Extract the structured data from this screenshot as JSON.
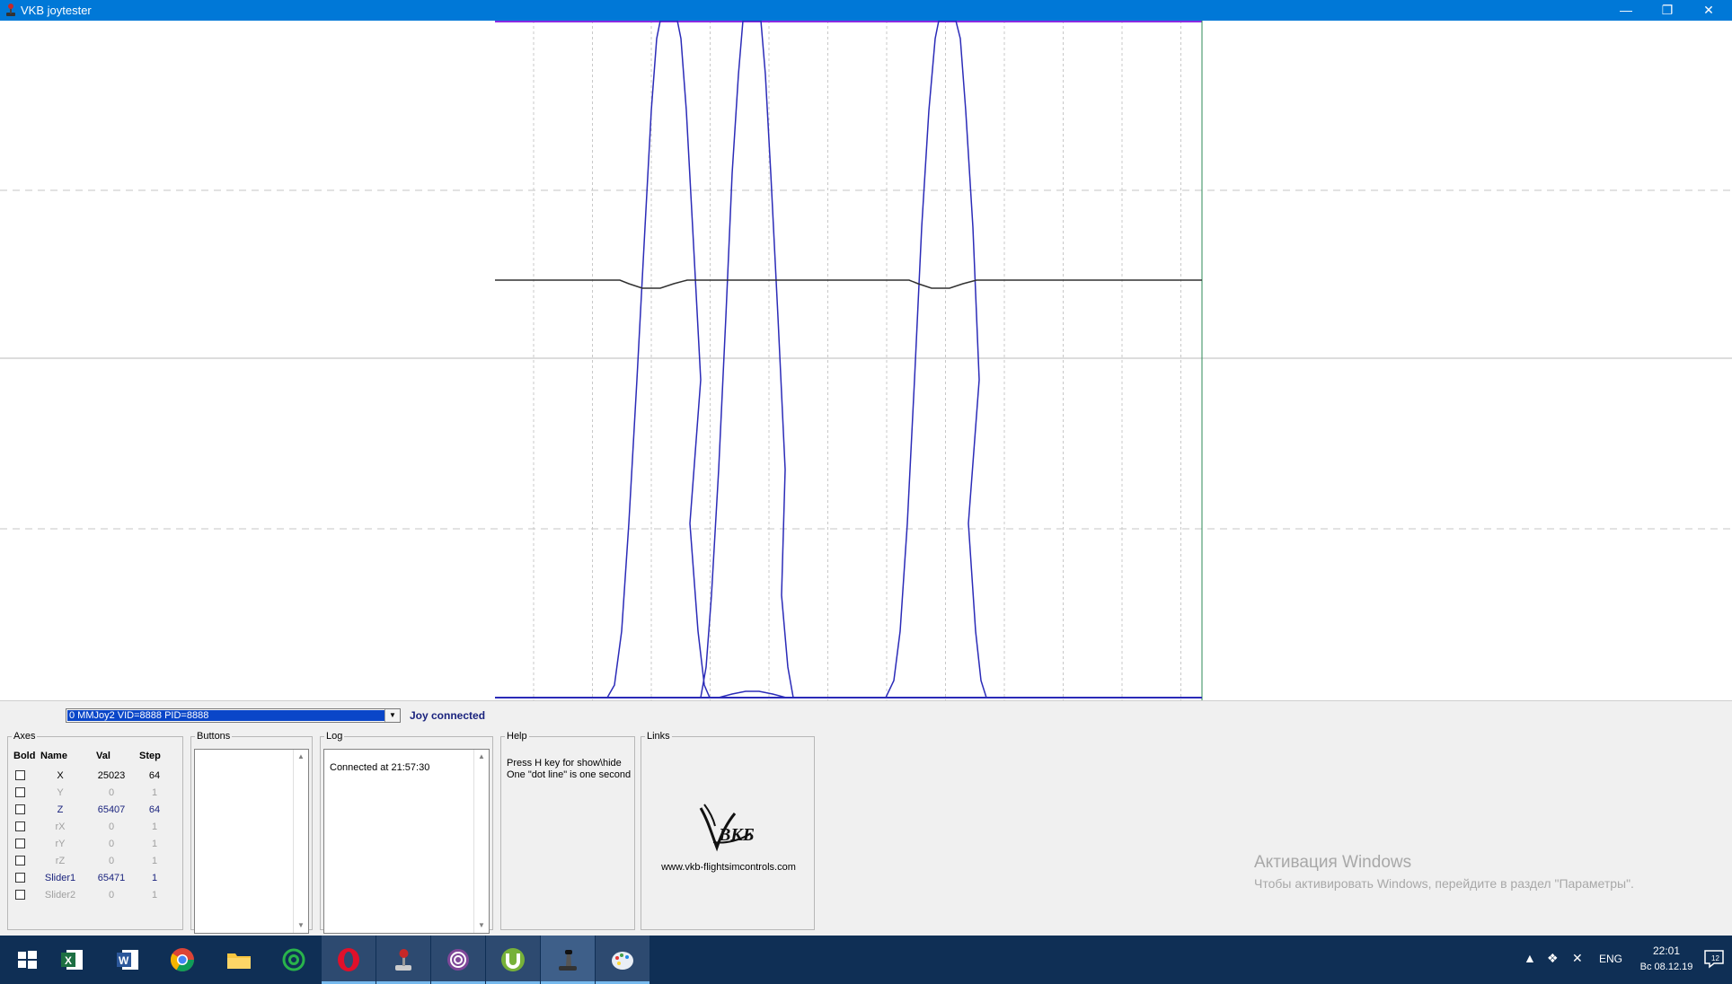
{
  "window": {
    "title": "VKB joytester"
  },
  "device": {
    "selected": "0 MMJoy2 VID=8888 PID=8888",
    "status": "Joy connected"
  },
  "axes": {
    "legend": "Axes",
    "headers": {
      "bold": "Bold",
      "name": "Name",
      "val": "Val",
      "step": "Step"
    },
    "rows": [
      {
        "name": "X",
        "val": "25023",
        "step": "64",
        "state": "active"
      },
      {
        "name": "Y",
        "val": "0",
        "step": "1",
        "state": "inactive"
      },
      {
        "name": "Z",
        "val": "65407",
        "step": "64",
        "state": "blue"
      },
      {
        "name": "rX",
        "val": "0",
        "step": "1",
        "state": "inactive"
      },
      {
        "name": "rY",
        "val": "0",
        "step": "1",
        "state": "inactive"
      },
      {
        "name": "rZ",
        "val": "0",
        "step": "1",
        "state": "inactive"
      },
      {
        "name": "Slider1",
        "val": "65471",
        "step": "1",
        "state": "blue"
      },
      {
        "name": "Slider2",
        "val": "0",
        "step": "1",
        "state": "inactive"
      }
    ]
  },
  "buttons": {
    "legend": "Buttons"
  },
  "log": {
    "legend": "Log",
    "text": "Connected at 21:57:30"
  },
  "help": {
    "legend": "Help",
    "line1": "Press H key for show\\hide",
    "line2": "One \"dot line\" is one second"
  },
  "links": {
    "legend": "Links",
    "url": "www.vkb-flightsimcontrols.com"
  },
  "watermark": {
    "title": "Активация Windows",
    "subtitle": "Чтобы активировать Windows, перейдите в раздел \"Параметры\"."
  },
  "taskbar": {
    "apps": [
      {
        "name": "start",
        "icon": "windows-logo-icon"
      },
      {
        "name": "excel",
        "icon": "excel-icon"
      },
      {
        "name": "word",
        "icon": "word-icon"
      },
      {
        "name": "chrome",
        "icon": "chrome-icon"
      },
      {
        "name": "explorer",
        "icon": "folder-icon"
      },
      {
        "name": "mail-ru",
        "icon": "at-sign-icon"
      },
      {
        "name": "opera",
        "icon": "opera-icon"
      },
      {
        "name": "joystick-app",
        "icon": "joystick-icon"
      },
      {
        "name": "tor-browser",
        "icon": "tor-icon"
      },
      {
        "name": "utorrent",
        "icon": "utorrent-icon"
      },
      {
        "name": "vkb-joytester",
        "icon": "joystick-icon"
      },
      {
        "name": "paint",
        "icon": "palette-icon"
      }
    ],
    "tray": {
      "lang": "ENG",
      "time": "22:01",
      "date": "Вс 08.12.19",
      "notifications": "12"
    }
  },
  "colors": {
    "accent": "#0078d7",
    "plot_blue": "#2b2bb8",
    "plot_dark": "#303030",
    "plot_purple": "#8a2be2",
    "plot_green": "#2e8b57"
  }
}
